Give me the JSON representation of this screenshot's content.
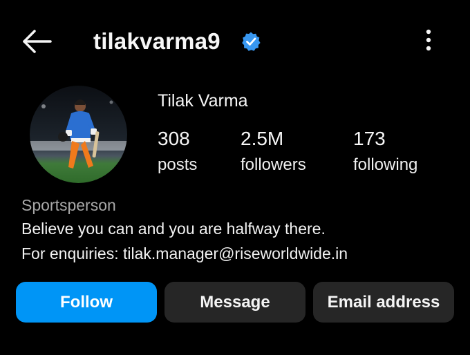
{
  "header": {
    "username": "tilakvarma9",
    "back_icon": "arrow-left-icon",
    "verified_icon": "verified-badge-icon",
    "more_icon": "more-vertical-icon"
  },
  "profile": {
    "full_name": "Tilak Varma",
    "avatar_icon": "profile-photo",
    "stats": {
      "posts": {
        "value": "308",
        "label": "posts"
      },
      "followers": {
        "value": "2.5M",
        "label": "followers"
      },
      "following": {
        "value": "173",
        "label": "following"
      }
    },
    "category": "Sportsperson",
    "bio_line1": "Believe you can and you are halfway there.",
    "bio_line2_prefix": "For enquiries: ",
    "bio_email": "tilak.manager@riseworldwide.in"
  },
  "actions": {
    "follow_label": "Follow",
    "message_label": "Message",
    "email_label": "Email address"
  },
  "colors": {
    "background": "#000000",
    "accent": "#0095f6",
    "secondary_button": "#262626",
    "verified": "#3897f0",
    "muted_text": "#a8a8a8"
  }
}
